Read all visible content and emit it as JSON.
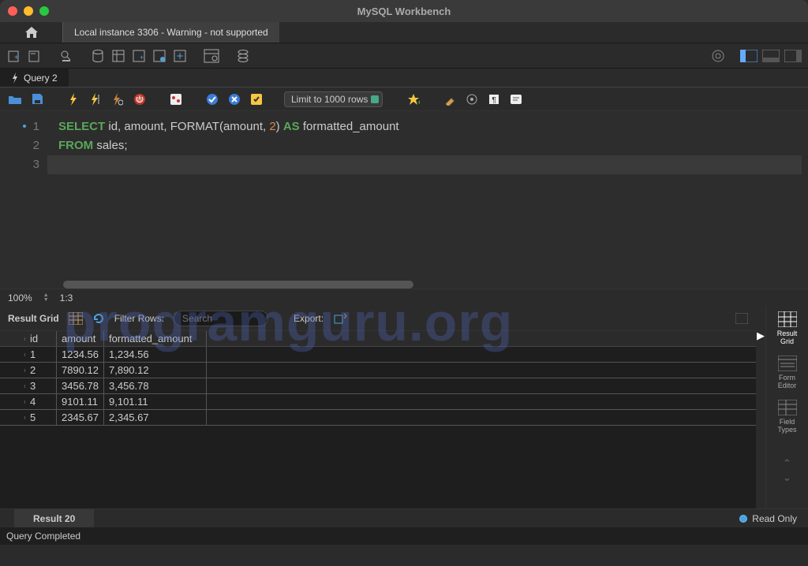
{
  "app_title": "MySQL Workbench",
  "connection_tab": "Local instance 3306 - Warning - not supported",
  "query_tab": "Query 2",
  "limit_select": "Limit to 1000 rows",
  "zoom": "100%",
  "cursor_pos": "1:3",
  "result_grid_label": "Result Grid",
  "filter_label": "Filter Rows:",
  "filter_placeholder": "Search",
  "export_label": "Export:",
  "side": {
    "grid": "Result\nGrid",
    "form": "Form\nEditor",
    "field": "Field\nTypes"
  },
  "result_tab": "Result 20",
  "readonly_label": "Read Only",
  "status": "Query Completed",
  "watermark": "programguru.org",
  "sql": {
    "l1a": "SELECT",
    "l1b": " id, amount, ",
    "l1c": "FORMAT",
    "l1d": "(amount, ",
    "l1e": "2",
    "l1f": ") ",
    "l1g": "AS",
    "l1h": " formatted_amount",
    "l2a": "FROM",
    "l2b": " sales;"
  },
  "columns": {
    "c1": "id",
    "c2": "amount",
    "c3": "formatted_amount"
  },
  "rows": [
    {
      "id": "1",
      "amount": "1234.56",
      "formatted": "1,234.56"
    },
    {
      "id": "2",
      "amount": "7890.12",
      "formatted": "7,890.12"
    },
    {
      "id": "3",
      "amount": "3456.78",
      "formatted": "3,456.78"
    },
    {
      "id": "4",
      "amount": "9101.11",
      "formatted": "9,101.11"
    },
    {
      "id": "5",
      "amount": "2345.67",
      "formatted": "2,345.67"
    }
  ]
}
